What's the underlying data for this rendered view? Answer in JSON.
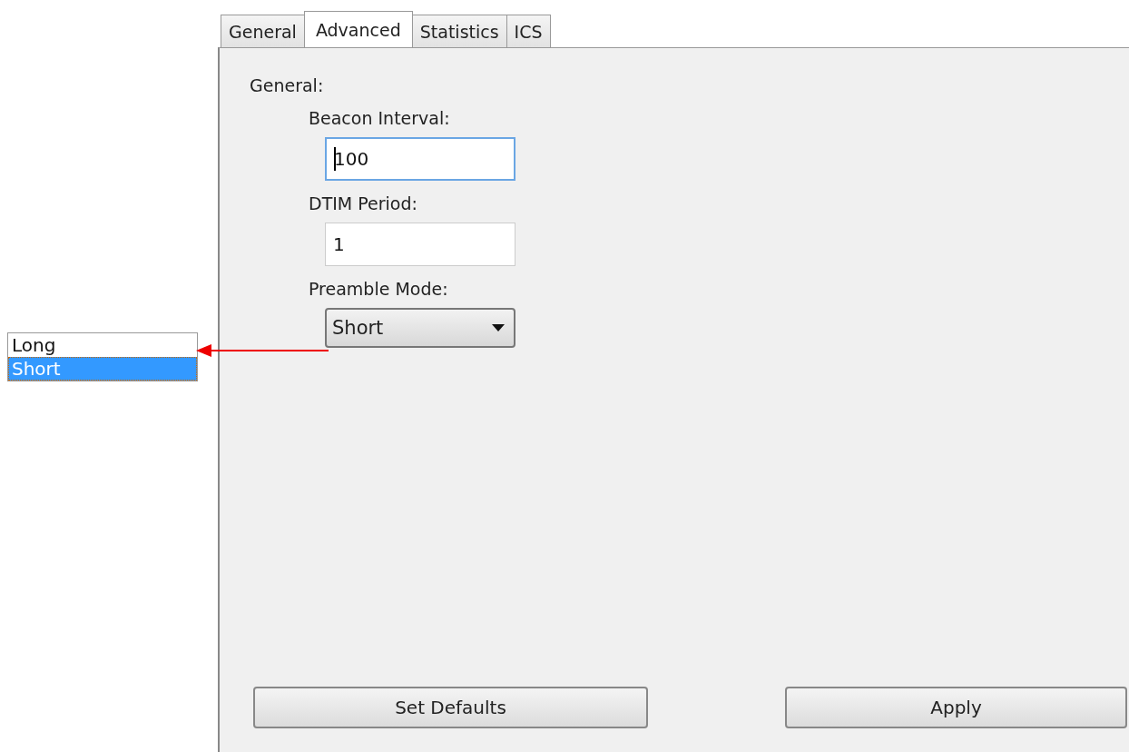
{
  "tabs": [
    {
      "label": "General",
      "selected": false
    },
    {
      "label": "Advanced",
      "selected": true
    },
    {
      "label": "Statistics",
      "selected": false
    },
    {
      "label": "ICS",
      "selected": false
    }
  ],
  "section_label": "General:",
  "fields": [
    {
      "kind": "text",
      "label": "Beacon Interval:",
      "value": "100",
      "focused": true
    },
    {
      "kind": "text",
      "label": "DTIM Period:",
      "value": "1",
      "focused": false
    },
    {
      "kind": "dropdown",
      "label": "Preamble Mode:",
      "value": "Short"
    }
  ],
  "dropdown_options": [
    {
      "label": "Long",
      "selected": false
    },
    {
      "label": "Short",
      "selected": true
    }
  ],
  "buttons": [
    "Set Defaults",
    "Apply"
  ]
}
